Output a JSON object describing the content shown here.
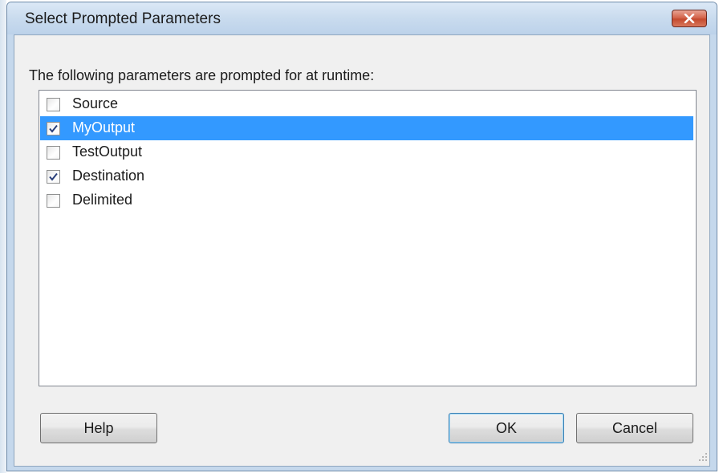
{
  "dialog": {
    "title": "Select Prompted Parameters",
    "prompt_label": "The following parameters are prompted for at runtime:",
    "parameters": [
      {
        "label": "Source",
        "checked": false,
        "selected": false
      },
      {
        "label": "MyOutput",
        "checked": true,
        "selected": true
      },
      {
        "label": "TestOutput",
        "checked": false,
        "selected": false
      },
      {
        "label": "Destination",
        "checked": true,
        "selected": false
      },
      {
        "label": "Delimited",
        "checked": false,
        "selected": false
      }
    ],
    "buttons": {
      "help": "Help",
      "ok": "OK",
      "cancel": "Cancel"
    }
  },
  "colors": {
    "selection": "#3399ff",
    "close_button": "#c44a2e",
    "dialog_face": "#f0f0f0",
    "titlebar": "#c9dbee"
  },
  "icons": {
    "close": "close-icon",
    "check": "checkmark-icon",
    "resize": "resize-grip-icon"
  }
}
